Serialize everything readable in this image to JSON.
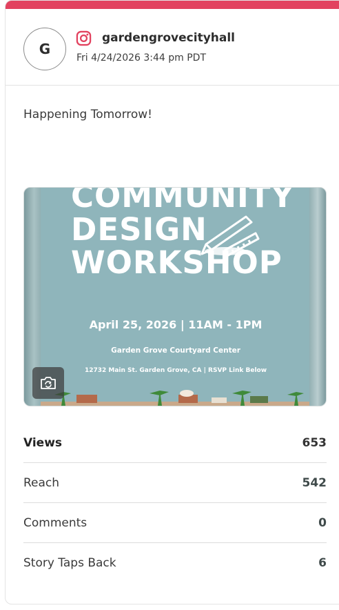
{
  "post": {
    "avatar_initial": "G",
    "platform_icon": "instagram-icon",
    "handle": "gardengrovecityhall",
    "timestamp": "Fri 4/24/2026 3:44 pm PDT",
    "caption": "Happening Tomorrow!"
  },
  "media": {
    "poster": {
      "title_line1": "COMMUNITY",
      "title_line2": "DESIGN",
      "title_line3": "WORKSHOP",
      "date_line": "April 25, 2026 | 11AM - 1PM",
      "venue": "Garden Grove Courtyard Center",
      "address": "12732 Main St. Garden Grove, CA | RSVP Link Below"
    },
    "overlay_icon": "camera-rotate-icon"
  },
  "stats": [
    {
      "label": "Views",
      "value": "653"
    },
    {
      "label": "Reach",
      "value": "542"
    },
    {
      "label": "Comments",
      "value": "0"
    },
    {
      "label": "Story Taps Back",
      "value": "6"
    }
  ],
  "colors": {
    "accent": "#e2425f",
    "poster_bg": "#8fb5bb"
  }
}
